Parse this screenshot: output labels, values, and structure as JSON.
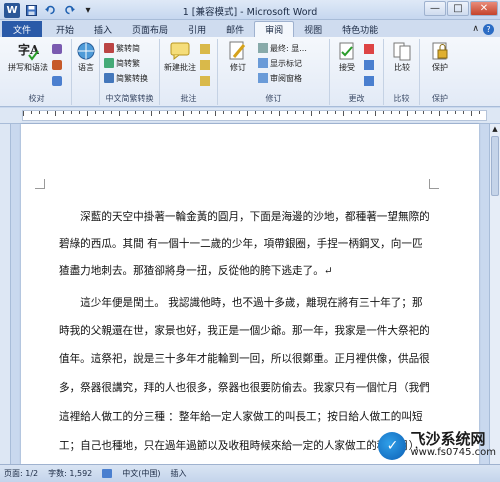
{
  "window": {
    "title": "1 [兼容模式] - Microsoft Word",
    "app_icon_letter": "W",
    "qat": {
      "save_icon": "save-icon",
      "undo_icon": "undo-icon",
      "redo_icon": "redo-icon"
    },
    "controls": {
      "minimize": "—",
      "maximize": "□",
      "close": "✕"
    }
  },
  "tabs": [
    {
      "label": "文件"
    },
    {
      "label": "开始"
    },
    {
      "label": "插入"
    },
    {
      "label": "页面布局"
    },
    {
      "label": "引用"
    },
    {
      "label": "邮件"
    },
    {
      "label": "审阅"
    },
    {
      "label": "视图"
    },
    {
      "label": "特色功能"
    }
  ],
  "active_tab": "审阅",
  "ribbon": {
    "proofing": {
      "label": "校对",
      "spelling": "拼写和语法"
    },
    "language": {
      "label": "语言"
    },
    "chinese_conv": {
      "label": "中文简繁转换",
      "to_simplified": "繁转简",
      "to_traditional": "简转繁",
      "convert": "简繁转换"
    },
    "comments": {
      "label": "批注",
      "new_comment": "新建批注"
    },
    "tracking": {
      "label": "修订",
      "track": "修订",
      "display": "最终: 显...",
      "show_markup": "显示标记",
      "review_pane": "审阅窗格"
    },
    "changes": {
      "label": "更改",
      "accept": "接受"
    },
    "compare": {
      "label": "比较",
      "compare": "比较"
    },
    "protect": {
      "label": "保护",
      "protect": "保护"
    }
  },
  "document": {
    "paragraphs": [
      "　　深藍的天空中掛著一輪金黃的圓月，下面是海邊的沙地，都種著一望無際的",
      "碧綠的西瓜。其間 有一個十一二歲的少年，項帶銀圈，手捏一柄鋼叉，向一匹",
      "猹盡力地刺去。那猹卻將身一扭，反從他的胯下逃走了。↵",
      "　　這少年便是閏土。 我認識他時，也不過十多歲，離現在將有三十年了；那",
      "時我的父親還在世，家景也好，我正是一個少爺。那一年，我家是一件大祭祀的",
      "值年。這祭祀，說是三十多年才能輪到一回，所以很鄭重。正月裡供像，供品很",
      "多，祭器很講究，拜的人也很多，祭器也很要防偷去。我家只有一個忙月（我們",
      "這裡給人做工的分三種 ：整年給一定人家做工的叫長工；按日給人做工的叫短",
      "工；自己也種地，只在過年過節以及收租時候來給一定的人家做工的稱忙月），"
    ]
  },
  "status_bar": {
    "page": "页面: 1/2",
    "words": "字数: 1,592",
    "language": "中文(中国)",
    "mode": "插入"
  },
  "watermark": {
    "logo_letter": "✓",
    "title": "飞沙系统网",
    "url": "www.fs0745.com"
  }
}
